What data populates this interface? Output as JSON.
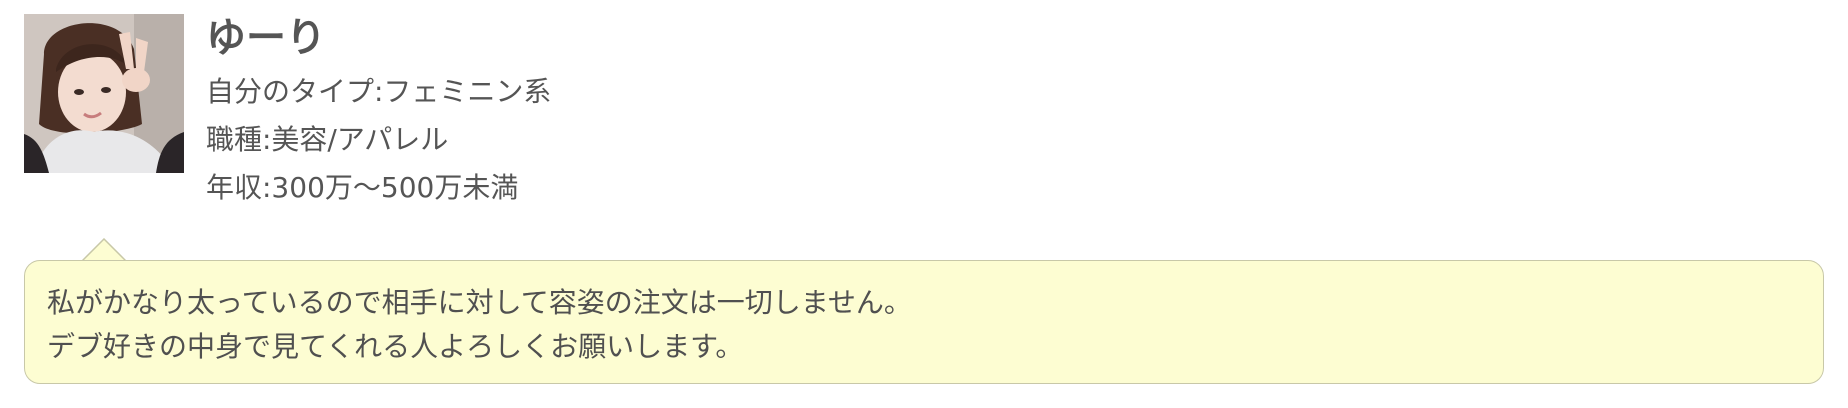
{
  "profile": {
    "name": "ゆーり",
    "attributes": [
      {
        "label": "自分のタイプ",
        "value": "フェミニン系",
        "display": "自分のタイプ:フェミニン系"
      },
      {
        "label": "職種",
        "value": "美容/アパレル",
        "display": "職種:美容/アパレル"
      },
      {
        "label": "年収",
        "value": "300万〜500万未満",
        "display": "年収:300万〜500万未満"
      }
    ]
  },
  "message": {
    "lines": [
      "私がかなり太っているので相手に対して容姿の注文は一切しません。",
      "デブ好きの中身で見てくれる人よろしくお願いします。"
    ]
  },
  "colors": {
    "bubble_background": "#fdfdd2",
    "bubble_border": "#c8c8a8",
    "text": "#555555"
  },
  "icons": {
    "avatar": "user-photo"
  }
}
